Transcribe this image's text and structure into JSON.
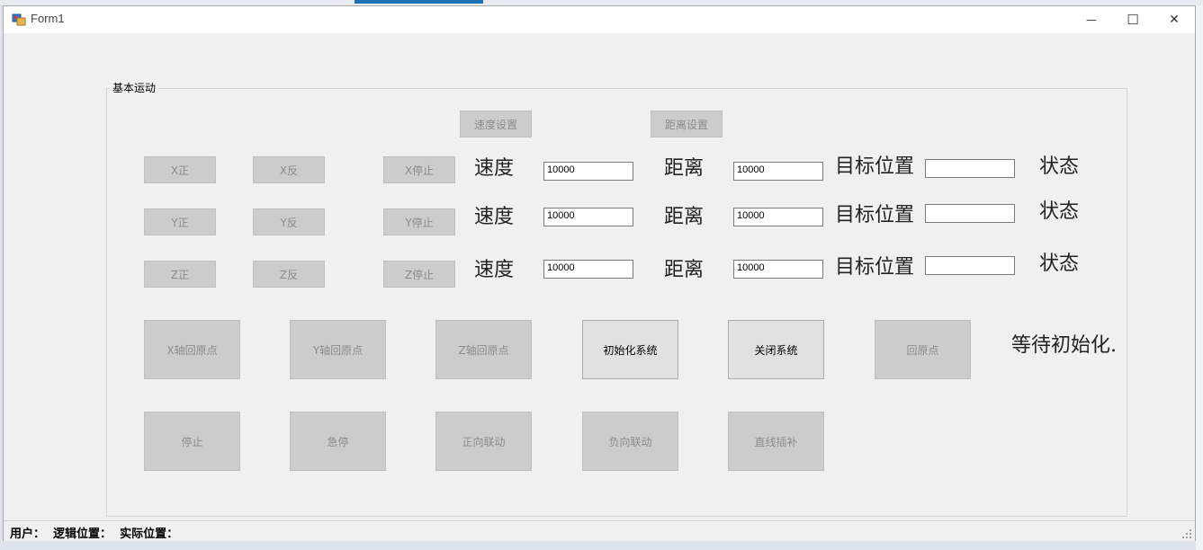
{
  "window": {
    "title": "Form1",
    "minimize_glyph": "—",
    "maximize_glyph": "☐",
    "close_glyph": "✕"
  },
  "group": {
    "label": "基本运动"
  },
  "settings_buttons": {
    "speed": "速度设置",
    "distance": "距离设置"
  },
  "axes": [
    {
      "pos": "X正",
      "neg": "X反",
      "stop": "X停止",
      "speed_label": "速度",
      "speed_value": "10000",
      "distance_label": "距离",
      "distance_value": "10000",
      "target_label": "目标位置",
      "target_value": "",
      "state_label": "状态"
    },
    {
      "pos": "Y正",
      "neg": "Y反",
      "stop": "Y停止",
      "speed_label": "速度",
      "speed_value": "10000",
      "distance_label": "距离",
      "distance_value": "10000",
      "target_label": "目标位置",
      "target_value": "",
      "state_label": "状态"
    },
    {
      "pos": "Z正",
      "neg": "Z反",
      "stop": "Z停止",
      "speed_label": "速度",
      "speed_value": "10000",
      "distance_label": "距离",
      "distance_value": "10000",
      "target_label": "目标位置",
      "target_value": "",
      "state_label": "状态"
    }
  ],
  "home_row": {
    "x_home": "X轴回原点",
    "y_home": "Y轴回原点",
    "z_home": "Z轴回原点",
    "init": "初始化系统",
    "close": "关闭系统",
    "home": "回原点",
    "status": "等待初始化."
  },
  "motion_row": {
    "stop": "停止",
    "estop": "急停",
    "forward": "正向联动",
    "backward": "负向联动",
    "linear": "直线插补"
  },
  "statusbar": {
    "text": "用户：  逻辑位置：  实际位置："
  },
  "colors": {
    "disabled_button": "#cccccc",
    "enabled_button": "#e1e1e1",
    "accent": "#1f6fb5"
  }
}
